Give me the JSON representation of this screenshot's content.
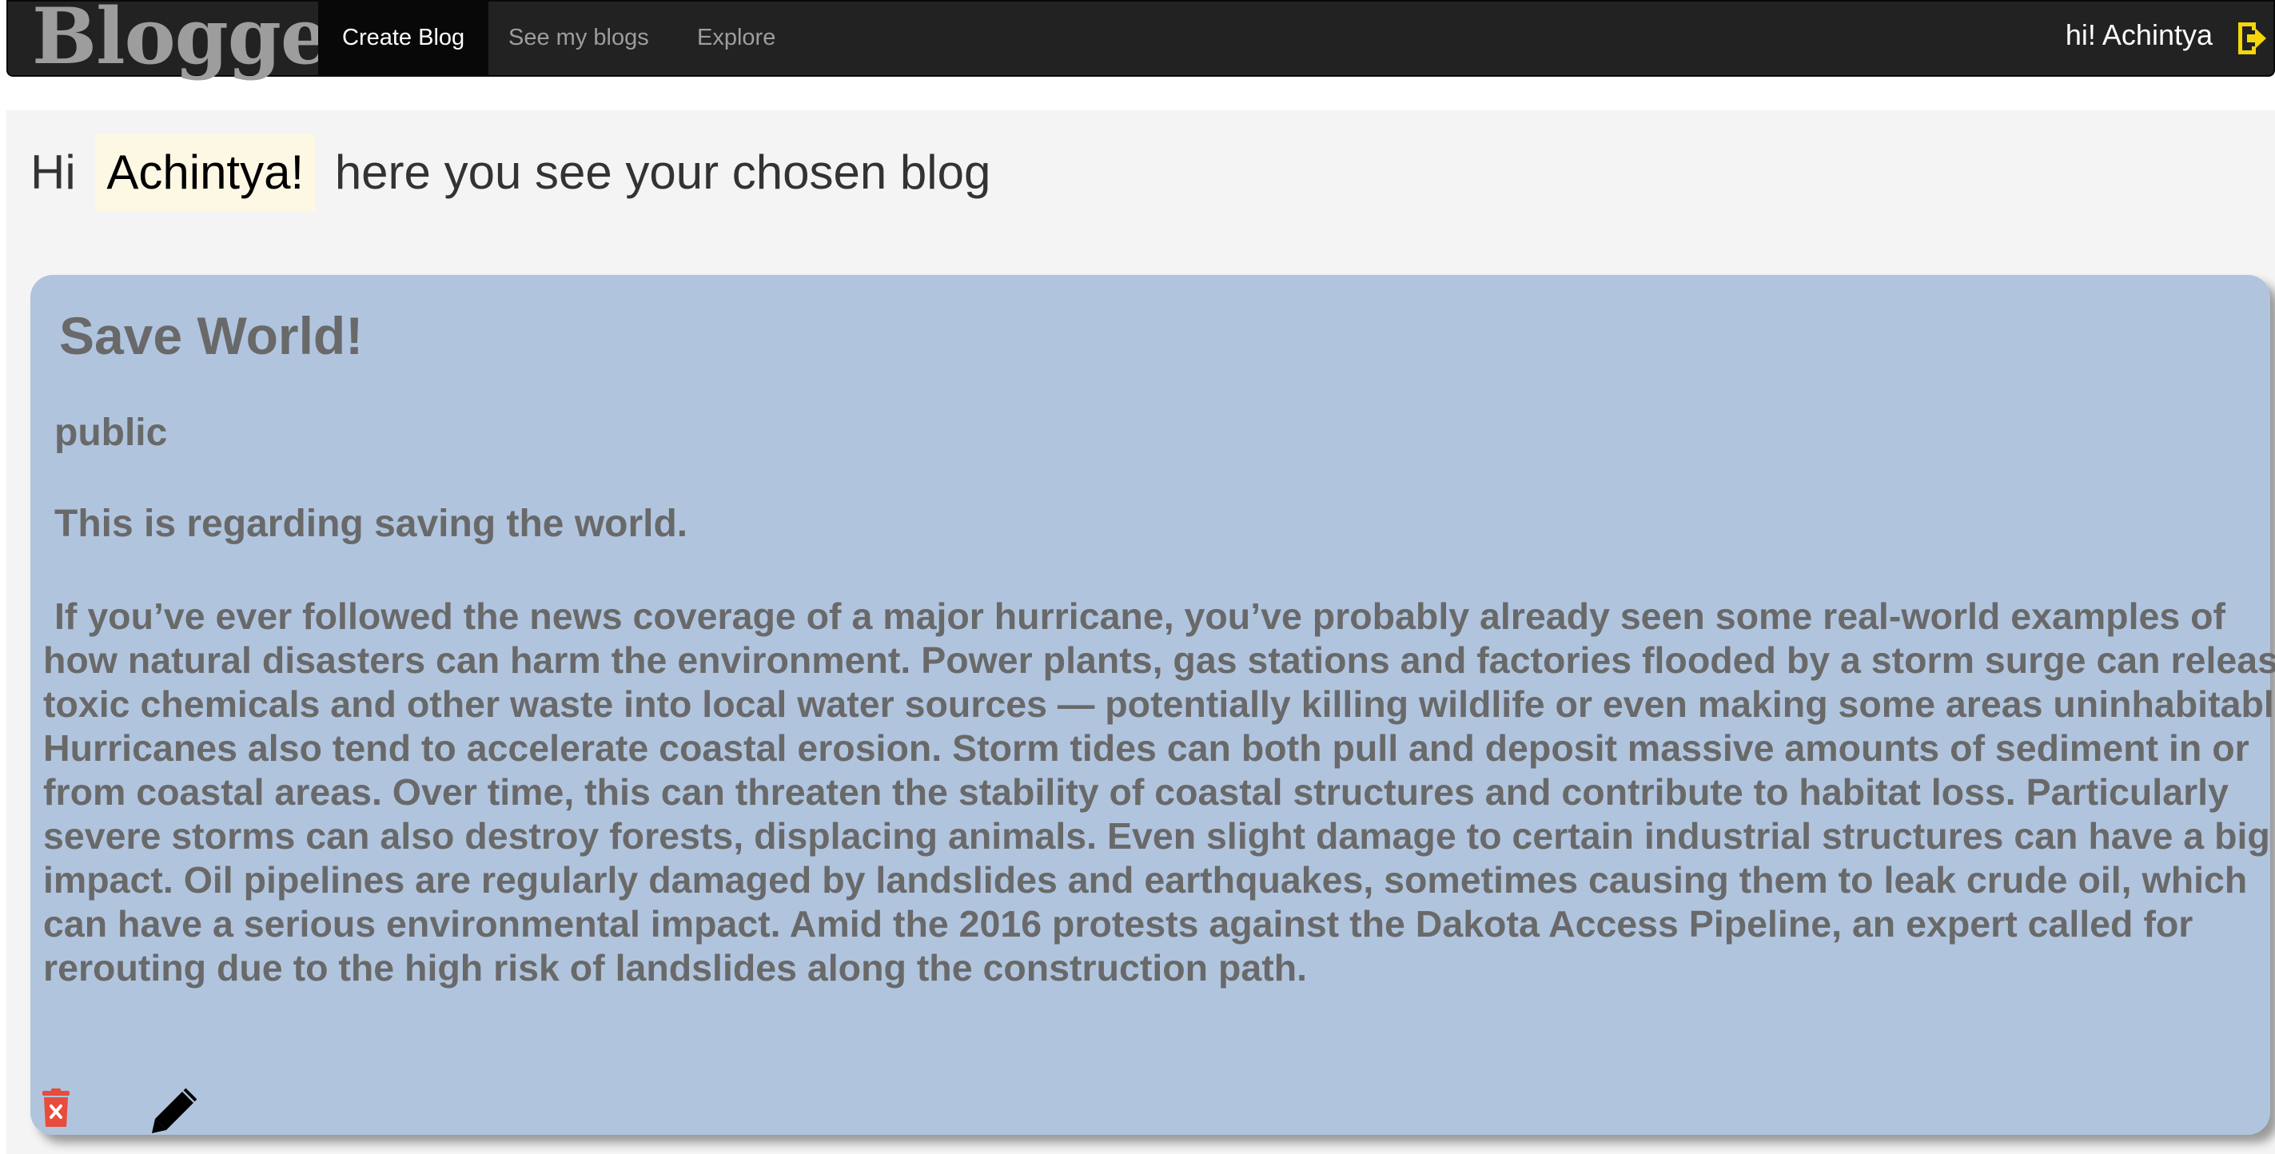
{
  "navbar": {
    "brand": "Blogger",
    "items": [
      {
        "label": "Create Blog",
        "active": true
      },
      {
        "label": "See my blogs",
        "active": false
      },
      {
        "label": "Explore",
        "active": false
      }
    ],
    "user_greeting": "hi! Achintya",
    "logout_icon": "sign-out-icon",
    "logout_icon_color": "#f5d60b"
  },
  "page": {
    "hi_prefix": "Hi",
    "user_name": "Achintya!",
    "hi_suffix": "here you see your chosen blog"
  },
  "blog": {
    "title": "Save World!",
    "visibility": "public",
    "summary": "This is regarding saving the world.",
    "body": "If you’ve ever followed the news coverage of a major hurricane, you’ve probably already seen some real-world examples of how natural disasters can harm the environment. Power plants, gas stations and factories flooded by a storm surge can release toxic chemicals and other waste into local water sources — potentially killing wildlife or even making some areas uninhabitable. Hurricanes also tend to accelerate coastal erosion. Storm tides can both pull and deposit massive amounts of sediment in or from coastal areas. Over time, this can threaten the stability of coastal structures and contribute to habitat loss. Particularly severe storms can also destroy forests, displacing animals. Even slight damage to certain industrial structures can have a big impact. Oil pipelines are regularly damaged by landslides and earthquakes, sometimes causing them to leak crude oil, which can have a serious environmental impact. Amid the 2016 protests against the Dakota Access Pipeline, an expert called for rerouting due to the high risk of landslides along the construction path.",
    "card_color": "#b0c4de",
    "actions": [
      {
        "icon": "trash-icon",
        "color": "#e74c3c"
      },
      {
        "icon": "pencil-icon",
        "color": "#000000"
      }
    ]
  }
}
